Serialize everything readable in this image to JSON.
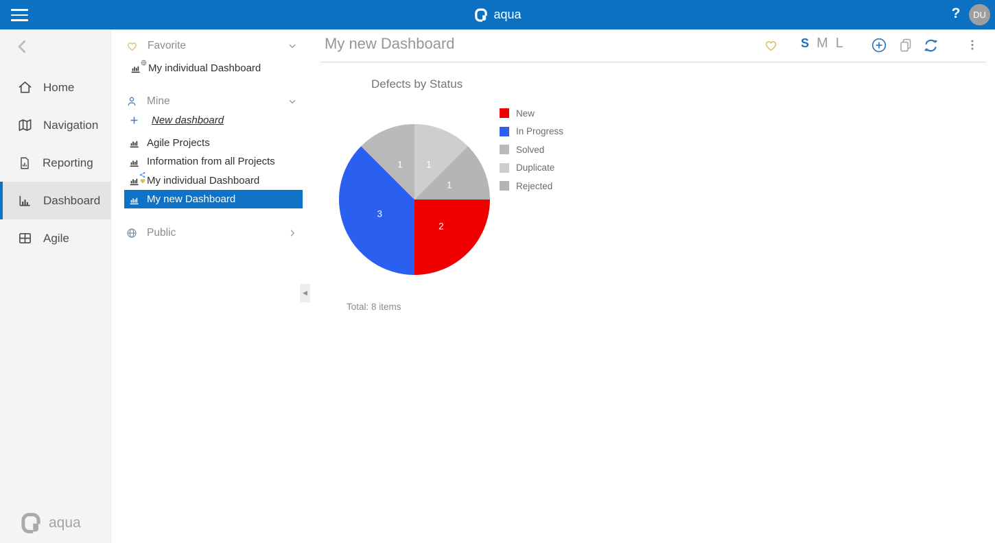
{
  "topbar": {
    "brand": "aqua",
    "help": "?",
    "avatar": "DU"
  },
  "sidebar": {
    "items": [
      {
        "label": "Home",
        "icon": "home-icon",
        "selected": false
      },
      {
        "label": "Navigation",
        "icon": "navigation-icon",
        "selected": false
      },
      {
        "label": "Reporting",
        "icon": "reporting-icon",
        "selected": false
      },
      {
        "label": "Dashboard",
        "icon": "dashboard-icon",
        "selected": true
      },
      {
        "label": "Agile",
        "icon": "agile-icon",
        "selected": false
      }
    ],
    "footer_brand": "aqua"
  },
  "panel": {
    "favorite": {
      "label": "Favorite",
      "items": [
        {
          "label": "My individual Dashboard",
          "badge": "globe"
        }
      ]
    },
    "mine": {
      "label": "Mine",
      "new_link": "New dashboard",
      "items": [
        {
          "label": "Agile Projects",
          "selected": false,
          "badges": []
        },
        {
          "label": "Information from all Projects",
          "selected": false,
          "badges": []
        },
        {
          "label": "My individual Dashboard",
          "selected": false,
          "badges": [
            "share",
            "favorite"
          ]
        },
        {
          "label": "My new Dashboard",
          "selected": true,
          "badges": []
        }
      ]
    },
    "public": {
      "label": "Public"
    }
  },
  "main": {
    "title": "My new Dashboard",
    "sizes": [
      "S",
      "M",
      "L"
    ],
    "active_size": "S"
  },
  "chart_data": {
    "type": "pie",
    "title": "Defects by Status",
    "series": [
      {
        "name": "New",
        "value": 2,
        "color": "#ee0000"
      },
      {
        "name": "In Progress",
        "value": 3,
        "color": "#2b5ff0"
      },
      {
        "name": "Solved",
        "value": 1,
        "color": "#bababa"
      },
      {
        "name": "Duplicate",
        "value": 1,
        "color": "#cecece"
      },
      {
        "name": "Rejected",
        "value": 1,
        "color": "#b5b5b5"
      }
    ],
    "total": 8,
    "start_angle_deg": 0,
    "direction": "clockwise",
    "label_color": "#ffffff",
    "legend_position": "right",
    "total_label": "Total: 8 items"
  },
  "colors": {
    "topbar_blue": "#0c71c2",
    "selection_blue": "#0f72c4",
    "accent_blue": "#2e77c0",
    "favorite_gold": "#dfbc66"
  }
}
